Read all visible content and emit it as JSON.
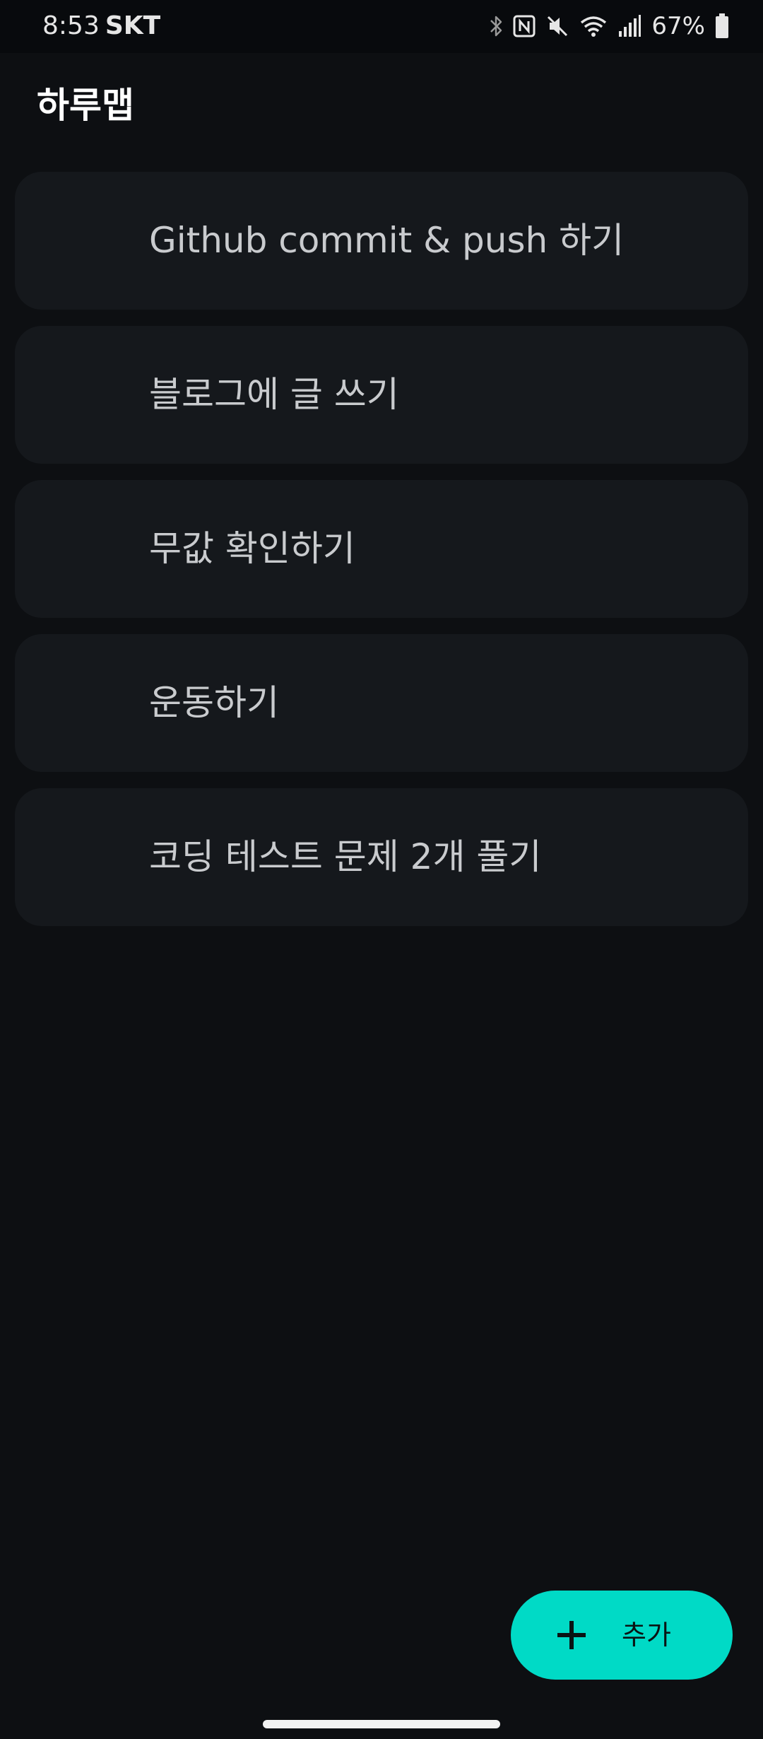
{
  "status_bar": {
    "time": "8:53",
    "carrier": "SKT",
    "battery": "67%",
    "icons": [
      "bluetooth-icon",
      "nfc-icon",
      "mute-icon",
      "wifi-icon",
      "signal-icon",
      "battery-icon"
    ]
  },
  "app": {
    "title": "하루맵"
  },
  "tasks": [
    {
      "label": "Github commit & push 하기"
    },
    {
      "label": "블로그에 글 쓰기"
    },
    {
      "label": "무값 확인하기"
    },
    {
      "label": "운동하기"
    },
    {
      "label": "코딩 테스트 문제 2개 풀기"
    }
  ],
  "fab": {
    "label": "추가",
    "icon": "plus-icon"
  },
  "colors": {
    "background": "#0d0f12",
    "card": "#15181c",
    "accent": "#00dac6"
  }
}
